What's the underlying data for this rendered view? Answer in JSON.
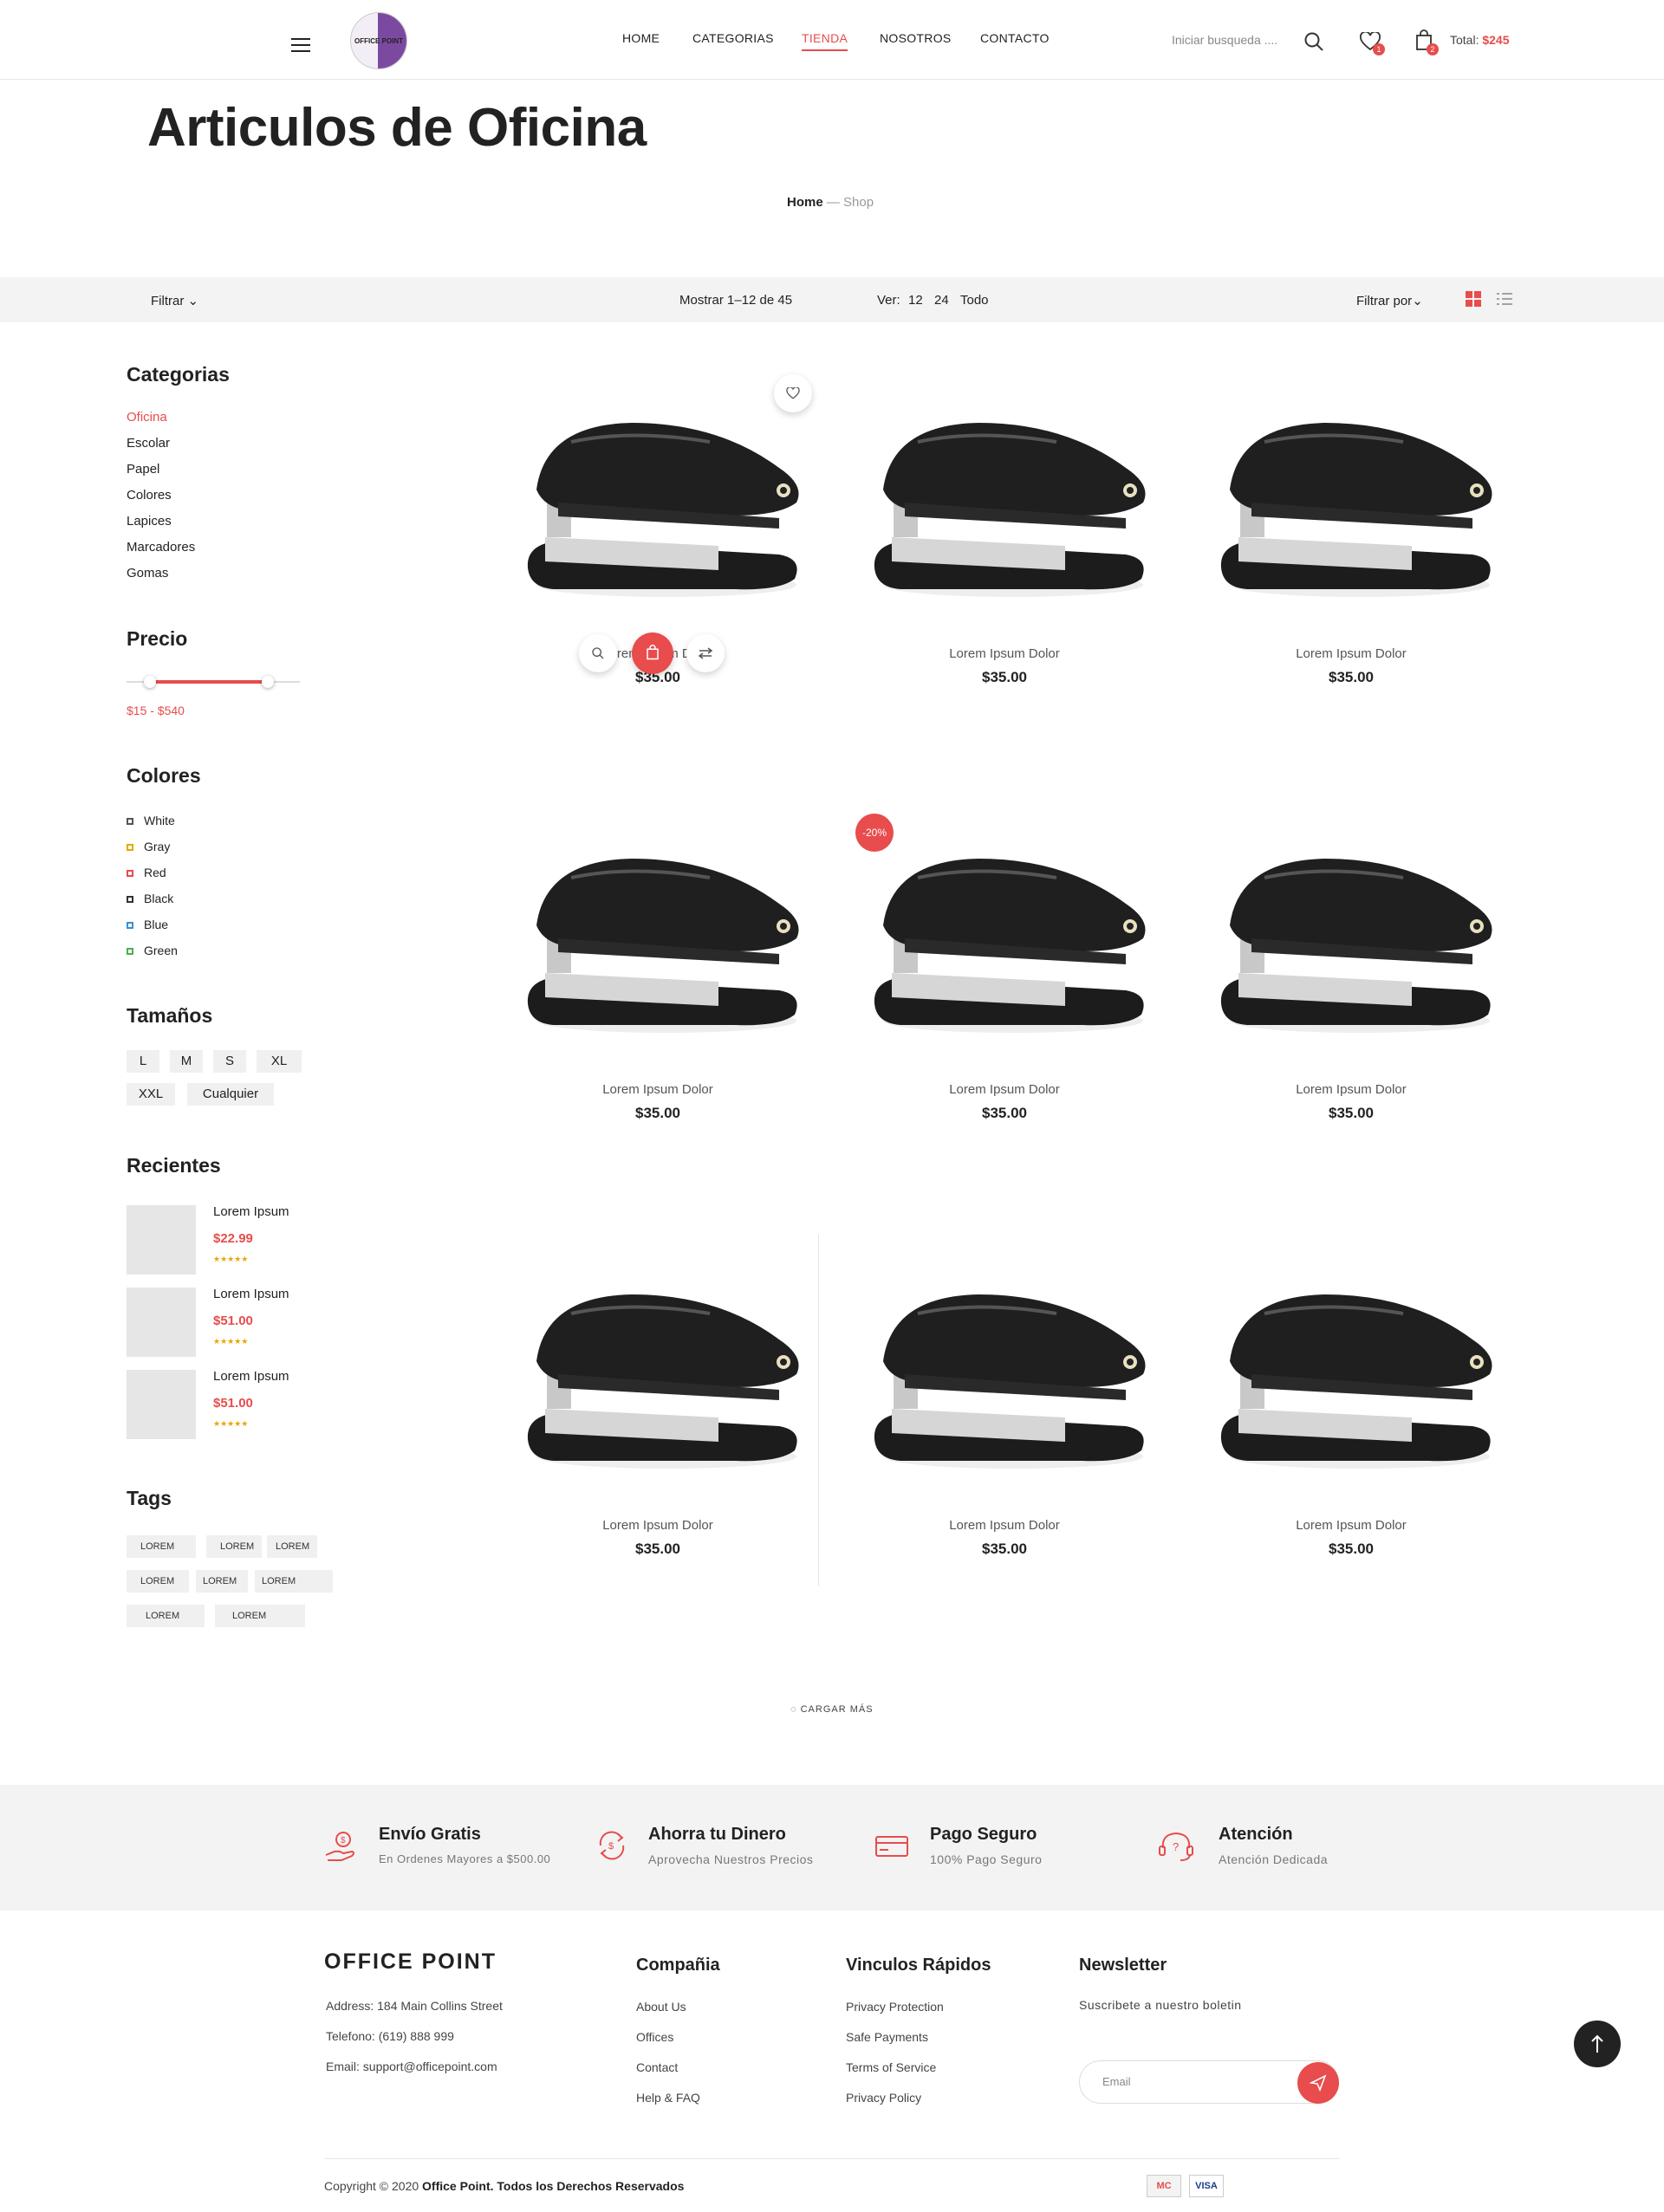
{
  "header": {
    "nav": [
      "HOME",
      "CATEGORIAS",
      "TIENDA",
      "NOSOTROS",
      "CONTACTO"
    ],
    "logo_text": "OFFICE POINT",
    "search_placeholder": "Iniciar busqueda ....",
    "wishlist_count": "1",
    "cart_count": "2",
    "total_label": "Total:",
    "total_value": "$245"
  },
  "page": {
    "title": "Articulos de Oficina",
    "breadcrumb_home": "Home",
    "breadcrumb_sep": " — ",
    "breadcrumb_current": "Shop"
  },
  "toolbar": {
    "filter": "Filtrar",
    "showing": "Mostrar 1–12 de 45",
    "view_label": "Ver:",
    "view_options": [
      "12",
      "24",
      "Todo"
    ],
    "sort": "Filtrar por"
  },
  "sidebar": {
    "categories_title": "Categorias",
    "categories": [
      "Oficina",
      "Escolar",
      "Papel",
      "Colores",
      "Lapices",
      "Marcadores",
      "Gomas"
    ],
    "price_title": "Precio",
    "price_range": "$15  -  $540",
    "colors_title": "Colores",
    "colors": [
      {
        "name": "White",
        "swatch": "#555555"
      },
      {
        "name": "Gray",
        "swatch": "#e8a600"
      },
      {
        "name": "Red",
        "swatch": "#e84c4c"
      },
      {
        "name": "Black",
        "swatch": "#333333"
      },
      {
        "name": "Blue",
        "swatch": "#3a8ed6"
      },
      {
        "name": "Green",
        "swatch": "#4caf50"
      }
    ],
    "sizes_title": "Tamaños",
    "sizes": [
      "L",
      "M",
      "S",
      "XL",
      "XXL",
      "Cualquier"
    ],
    "recent_title": "Recientes",
    "recent": [
      {
        "name": "Lorem Ipsum",
        "price": "$22.99",
        "stars": "★★★★★"
      },
      {
        "name": "Lorem Ipsum",
        "price": "$51.00",
        "stars": "★★★★★"
      },
      {
        "name": "Lorem Ipsum",
        "price": "$51.00",
        "stars": "★★★★★"
      }
    ],
    "tags_title": "Tags",
    "tags": [
      "LOREM",
      "LOREM",
      "LOREM",
      "LOREM",
      "LOREM",
      "LOREM",
      "LOREM",
      "LOREM"
    ]
  },
  "products": [
    {
      "name": "Lorem Ipsum Dolor",
      "price": "$35.00"
    },
    {
      "name": "Lorem Ipsum Dolor",
      "price": "$35.00"
    },
    {
      "name": "Lorem Ipsum Dolor",
      "price": "$35.00"
    },
    {
      "name": "Lorem Ipsum Dolor",
      "price": "$35.00"
    },
    {
      "name": "Lorem Ipsum Dolor",
      "price": "$35.00",
      "badge": "-20%"
    },
    {
      "name": "Lorem Ipsum Dolor",
      "price": "$35.00"
    },
    {
      "name": "Lorem Ipsum Dolor",
      "price": "$35.00"
    },
    {
      "name": "Lorem Ipsum Dolor",
      "price": "$35.00"
    },
    {
      "name": "Lorem Ipsum Dolor",
      "price": "$35.00"
    }
  ],
  "load_more": "CARGAR MÁS",
  "features": [
    {
      "title": "Envío Gratis",
      "sub": "En Ordenes Mayores a $500.00",
      "icon": "delivery-hand-icon"
    },
    {
      "title": "Ahorra tu Dinero",
      "sub": "Aprovecha Nuestros Precios",
      "icon": "money-cycle-icon"
    },
    {
      "title": "Pago Seguro",
      "sub": "100% Pago Seguro",
      "icon": "credit-card-icon"
    },
    {
      "title": "Atención",
      "sub": "Atención Dedicada",
      "icon": "support-icon"
    }
  ],
  "footer": {
    "brand": "OFFICE POINT",
    "address": "Address: 184 Main Collins Street",
    "phone": "Telefono: (619) 888 999",
    "email": "Email: support@officepoint.com",
    "company_title": "Compañia",
    "company_links": [
      "About Us",
      "Offices",
      "Contact",
      "Help & FAQ"
    ],
    "quick_title": "Vinculos Rápidos",
    "quick_links": [
      "Privacy Protection",
      "Safe Payments",
      "Terms of Service",
      "Privacy Policy"
    ],
    "news_title": "Newsletter",
    "news_sub": "Suscribete a nuestro boletin",
    "news_placeholder": "Email",
    "copyright_prefix": "Copyright © 2020 ",
    "copyright_brand": "Office Point. Todos los Derechos Reservados",
    "cards": [
      "MC",
      "VISA"
    ]
  },
  "colors": {
    "accent": "#e84c4c",
    "text": "#222222",
    "band": "#f3f3f3"
  }
}
